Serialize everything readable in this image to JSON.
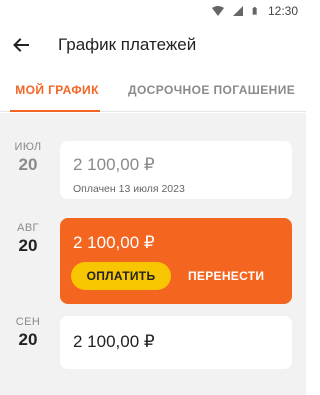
{
  "status_bar": {
    "time": "12:30",
    "icons": [
      "wifi-icon",
      "signal-icon",
      "battery-icon"
    ]
  },
  "header": {
    "title": "График платежей",
    "back_icon": "arrow-left-icon"
  },
  "tabs": [
    {
      "label": "МОЙ ГРАФИК",
      "active": true
    },
    {
      "label": "ДОСРОЧНОЕ ПОГАШЕНИЕ",
      "active": false
    }
  ],
  "payments": [
    {
      "month": "ИЮЛ",
      "day": "20",
      "amount": "2 100,00 ₽",
      "note": "Оплачен 13 июля 2023",
      "status": "paid"
    },
    {
      "month": "АВГ",
      "day": "20",
      "amount": "2 100,00 ₽",
      "status": "due",
      "pay_label": "ОПЛАТИТЬ",
      "postpone_label": "ПЕРЕНЕСТИ"
    },
    {
      "month": "СЕН",
      "day": "20",
      "amount": "2 100,00 ₽",
      "status": "future"
    }
  ],
  "colors": {
    "accent": "#f36523",
    "due_card": "#f4661f",
    "pay_button": "#f7c600",
    "background": "#f2f2f2"
  }
}
